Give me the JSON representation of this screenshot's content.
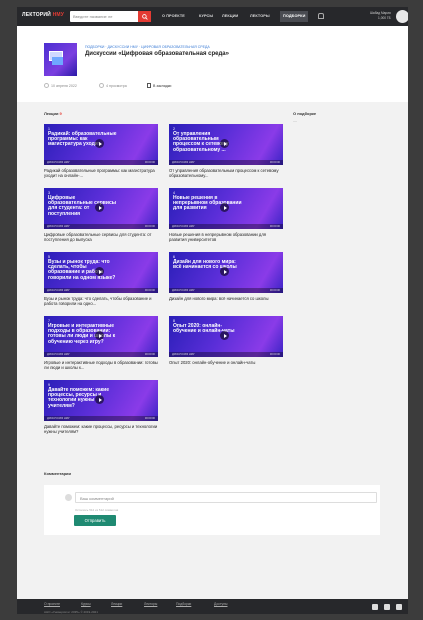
{
  "topbar": {
    "logo_main": "ЛЕКТОРИЙ",
    "logo_accent": "НМУ",
    "search_placeholder": "Введите название ле",
    "nav": [
      "О ПРОЕКТЕ",
      "КУРСЫ",
      "ЛЕКЦИИ",
      "ЛЕКТОРЫ",
      "ПОДБОРКИ"
    ],
    "active_nav": "ПОДБОРКИ",
    "user_name": "Шабад Мария",
    "user_sub": "1,000 ГБ"
  },
  "header": {
    "breadcrumb": "ПОДБОРКИ · ДИСКУССИИ НМУ · ЦИФРОВАЯ ОБРАЗОВАТЕЛЬНАЯ СРЕДА",
    "title": "Дискуссии «Цифровая образовательная среда»",
    "date": "10 апреля 2022",
    "views": "4 просмотра",
    "bookmark": "В закладки"
  },
  "lectures_label": "Лекции",
  "lectures_count": "9",
  "about_label": "О подборке",
  "about_text": "—",
  "cards": [
    {
      "num": "1",
      "img": "Радикай: образовательные программы: как магистратура уходит",
      "bar": "ДИСКУССИЯ НМУ",
      "time": "00:00:00",
      "cap": "Радикай образовательные программы: как магистратура уходит на онлайн-..."
    },
    {
      "num": "2",
      "img": "От управления образовательным процессом к сетевому образовательному ...",
      "bar": "ДИСКУССИЯ НМУ",
      "time": "00:00:00",
      "cap": "От управления образовательным процессом к сетевому образовательному..."
    },
    {
      "num": "3",
      "img": "Цифровые образовательные сервисы для студента: от поступления",
      "bar": "ДИСКУССИЯ НМУ",
      "time": "00:00:00",
      "cap": "Цифровые образовательные сервисы для студента: от поступления до выпуска"
    },
    {
      "num": "4",
      "img": "Новые решения в непрерывном образовании для развития",
      "bar": "ДИСКУССИЯ НМУ",
      "time": "00:00:00",
      "cap": "Новые решения в непрерывном образовании для развития университетов"
    },
    {
      "num": "5",
      "img": "Вузы и рынок труда: что сделать, чтобы образование и работа говорили на одном языке?",
      "bar": "ДИСКУССИЯ НМУ",
      "time": "00:00:00",
      "cap": "Вузы и рынок труда: что сделать, чтобы образование и работа говорили на одно..."
    },
    {
      "num": "6",
      "img": "Дизайн для нового мира: всё начинается со школы",
      "bar": "ДИСКУССИЯ НМУ",
      "time": "00:00:00",
      "cap": "Дизайн для нового мира: всё начинается со школы"
    },
    {
      "num": "7",
      "img": "Игровые и интерактивные подходы в образовании: готовы ли люди и школы к обучению через игру?",
      "bar": "ДИСКУССИЯ НМУ",
      "time": "00:00:00",
      "cap": "Игровые и интерактивные подходы в образовании: готовы ли люди и школы к..."
    },
    {
      "num": "8",
      "img": "Опыт 2020: онлайн-обучение и онлайн-чаты",
      "bar": "ДИСКУССИЯ НМУ",
      "time": "00:00:00",
      "cap": "Опыт 2020: онлайн-обучение и онлайн-чаты"
    },
    {
      "num": "9",
      "img": "Давайте поможем: какие процессы, ресурсы и технологии нужны учителям?",
      "bar": "ДИСКУССИЯ НМУ",
      "time": "00:00:00",
      "cap": "Давайте поможем: какие процессы, ресурсы и технологии нужны учителям?"
    }
  ],
  "comments": {
    "label": "Комментарии",
    "placeholder": "Ваш комментарий",
    "hint": "Осталось 512 из 512 символов",
    "send": "Отправить"
  },
  "footer": {
    "links": [
      "О проекте",
      "Курсы",
      "Лекции",
      "Лекторы",
      "Подборки",
      "Доступы"
    ],
    "copyright": "АНО «Университет 2035» © 2019-2021"
  }
}
